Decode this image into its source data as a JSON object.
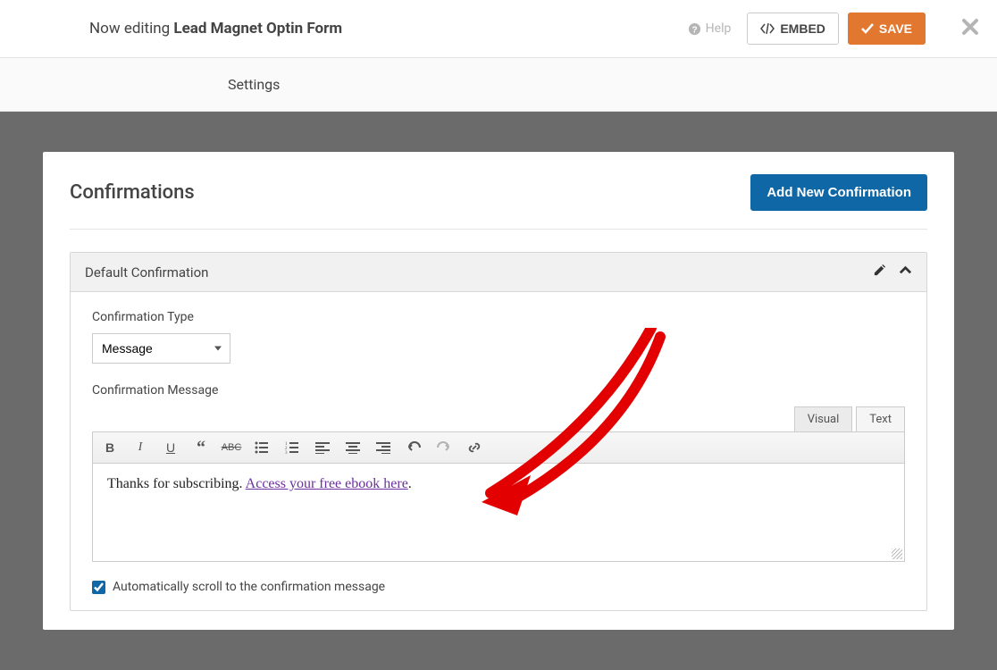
{
  "header": {
    "editing_prefix": "Now editing ",
    "form_name": "Lead Magnet Optin Form",
    "help_label": "Help",
    "embed_label": "EMBED",
    "save_label": "SAVE"
  },
  "subnav": {
    "settings_label": "Settings"
  },
  "panel": {
    "title": "Confirmations",
    "add_button_label": "Add New Confirmation"
  },
  "confirmation": {
    "title": "Default Confirmation",
    "type_label": "Confirmation Type",
    "type_value": "Message",
    "message_label": "Confirmation Message",
    "tabs": {
      "visual": "Visual",
      "text": "Text"
    },
    "message_text_prefix": "Thanks for subscribing. ",
    "message_link_text": "Access your free ebook here",
    "message_text_suffix": ".",
    "autoscroll_label": "Automatically scroll to the confirmation message",
    "autoscroll_checked": true
  },
  "toolbar_icons": [
    "bold",
    "italic",
    "underline",
    "blockquote",
    "strikethrough",
    "bullet-list",
    "number-list",
    "align-left",
    "align-center",
    "align-right",
    "undo",
    "redo",
    "link"
  ]
}
